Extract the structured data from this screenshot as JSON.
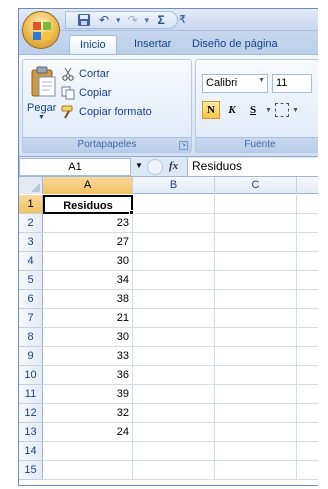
{
  "quick_access": {
    "save_icon": "save-icon",
    "undo_icon": "undo-icon",
    "redo_icon": "redo-icon",
    "sum_icon": "autosum-icon"
  },
  "ribbon_tabs": [
    {
      "label": "Inicio",
      "active": true
    },
    {
      "label": "Insertar",
      "active": false
    },
    {
      "label": "Diseño de página",
      "active": false
    }
  ],
  "clipboard_group": {
    "paste_label": "Pegar",
    "cut_label": "Cortar",
    "copy_label": "Copiar",
    "format_painter_label": "Copiar formato",
    "group_label": "Portapapeles"
  },
  "font_group": {
    "font_name": "Calibri",
    "font_size": "11",
    "bold_label": "N",
    "italic_label": "K",
    "underline_label": "S",
    "group_label": "Fuente"
  },
  "formula_bar": {
    "name_box": "A1",
    "fx_label": "fx",
    "content": "Residuos"
  },
  "columns": [
    "A",
    "B",
    "C"
  ],
  "rows": [
    {
      "num": "1",
      "a": "Residuos"
    },
    {
      "num": "2",
      "a": "23"
    },
    {
      "num": "3",
      "a": "27"
    },
    {
      "num": "4",
      "a": "30"
    },
    {
      "num": "5",
      "a": "34"
    },
    {
      "num": "6",
      "a": "38"
    },
    {
      "num": "7",
      "a": "21"
    },
    {
      "num": "8",
      "a": "30"
    },
    {
      "num": "9",
      "a": "33"
    },
    {
      "num": "10",
      "a": "36"
    },
    {
      "num": "11",
      "a": "39"
    },
    {
      "num": "12",
      "a": "32"
    },
    {
      "num": "13",
      "a": "24"
    },
    {
      "num": "14",
      "a": ""
    },
    {
      "num": "15",
      "a": ""
    }
  ],
  "colors": {
    "accent": "#15428b",
    "selected_header": "#f1c15f",
    "ribbon": "#dfe9f6"
  }
}
